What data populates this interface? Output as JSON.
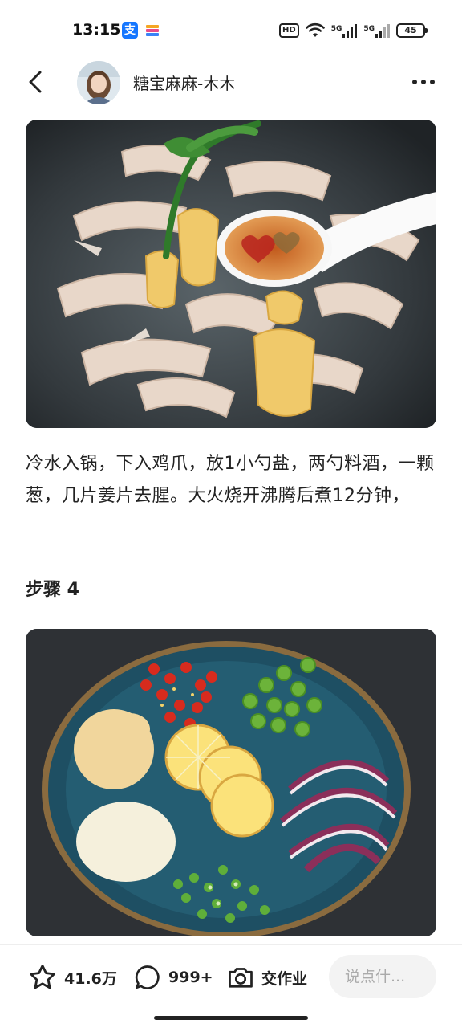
{
  "status_bar": {
    "time": "13:15",
    "alipay_glyph": "支",
    "hd_label": "HD",
    "network_1": "5G",
    "network_2": "5G",
    "battery": "45",
    "icons": [
      "alipay-icon",
      "app-stripe-icon",
      "hd-icon",
      "wifi-icon",
      "signal-icon",
      "signal-icon",
      "battery-icon"
    ]
  },
  "header": {
    "back_icon": "chevron-left-icon",
    "author_name": "糖宝麻麻-木木",
    "more_icon": "more-dots-icon"
  },
  "content": {
    "step_description": "冷水入锅，下入鸡爪，放1小勺盐，两勺料酒，一颗葱，几片姜片去腥。大火烧开沸腾后煮12分钟，",
    "next_step_title": "步骤 4"
  },
  "bottom_bar": {
    "favorite_count": "41.6万",
    "comment_count": "999+",
    "homework_label": "交作业",
    "comment_placeholder": "说点什..."
  },
  "colors": {
    "alipay_blue": "#1677ff",
    "text": "#222222",
    "input_bg": "#f3f3f3"
  }
}
